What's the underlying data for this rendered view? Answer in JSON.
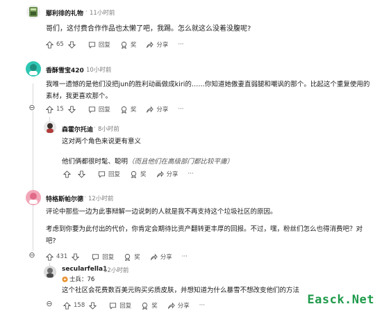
{
  "comments": [
    {
      "user": "鄢利徘的礼物",
      "dot": "·",
      "time": "11小时前",
      "lines": [
        "哥们，这付费合作作品也太懒了吧，我踢。怎么就这么没着没腹呢?"
      ],
      "votes": "65",
      "reply_label": "回复",
      "award_label": "奖",
      "share_label": "分享",
      "more_label": "···"
    },
    {
      "user": "香酥雪宝420",
      "dot": "·",
      "time": "10小时前",
      "lines": [
        "我唯一遗憾的是他们没把jun的胜利动画做成kiri的……你知道她傲妻直弱腿和嘲讽的那个。比起这个重复使用的",
        "素材，我更喜欢那个。"
      ],
      "votes": "15",
      "reply_label": "回复",
      "award_label": "奖",
      "share_label": "分享",
      "more_label": "···"
    },
    {
      "user": "森霍尔托迪",
      "dot": "·",
      "time": "8小时前",
      "line1": "这对两个角色来说更有意义",
      "line2_normal": "他们俩都很时髦、聪明",
      "line2_italic": "（而且他们在高级部门都比较平庸）",
      "reply_label": "回复",
      "award_label": "奖",
      "share_label": "分享",
      "more_label": "···"
    },
    {
      "user": "特格斯帕尔德",
      "dot": "·",
      "time": "12小时前",
      "lines": [
        "评论中那些一边为此事辩解一边说刺的人就是我不再支持这个垃圾社区的原因。"
      ],
      "lines2": [
        "考虑到你要为此付出的代价，你肯定会期待比资产翻转更丰厚的回报。不过，嘿，粉丝们怎么也得消费吧？对",
        "吧?"
      ],
      "votes": "431",
      "reply_label": "回复",
      "award_label": "奖",
      "share_label": "分享",
      "more_label": "···"
    },
    {
      "user": "secularfella1",
      "dot": "·",
      "time": "12小时前",
      "flair": "士兵：76",
      "lines": [
        "这个社区会花费数百美元购买劣质皮肤，并想知道为什么暴雪不想改变他们的方法"
      ],
      "votes": "158",
      "reply_label": "回复",
      "award_label": "奖",
      "share_label": "分享",
      "more_label": "···"
    }
  ],
  "collapse_symbol": "⊖",
  "watermark": "Easck.Net",
  "colors": {
    "avatar1": "#6a8f4e",
    "avatar2": "#2fc7b4",
    "avatar4": "#f2a7b8",
    "watermark": "#1e9a4a"
  }
}
